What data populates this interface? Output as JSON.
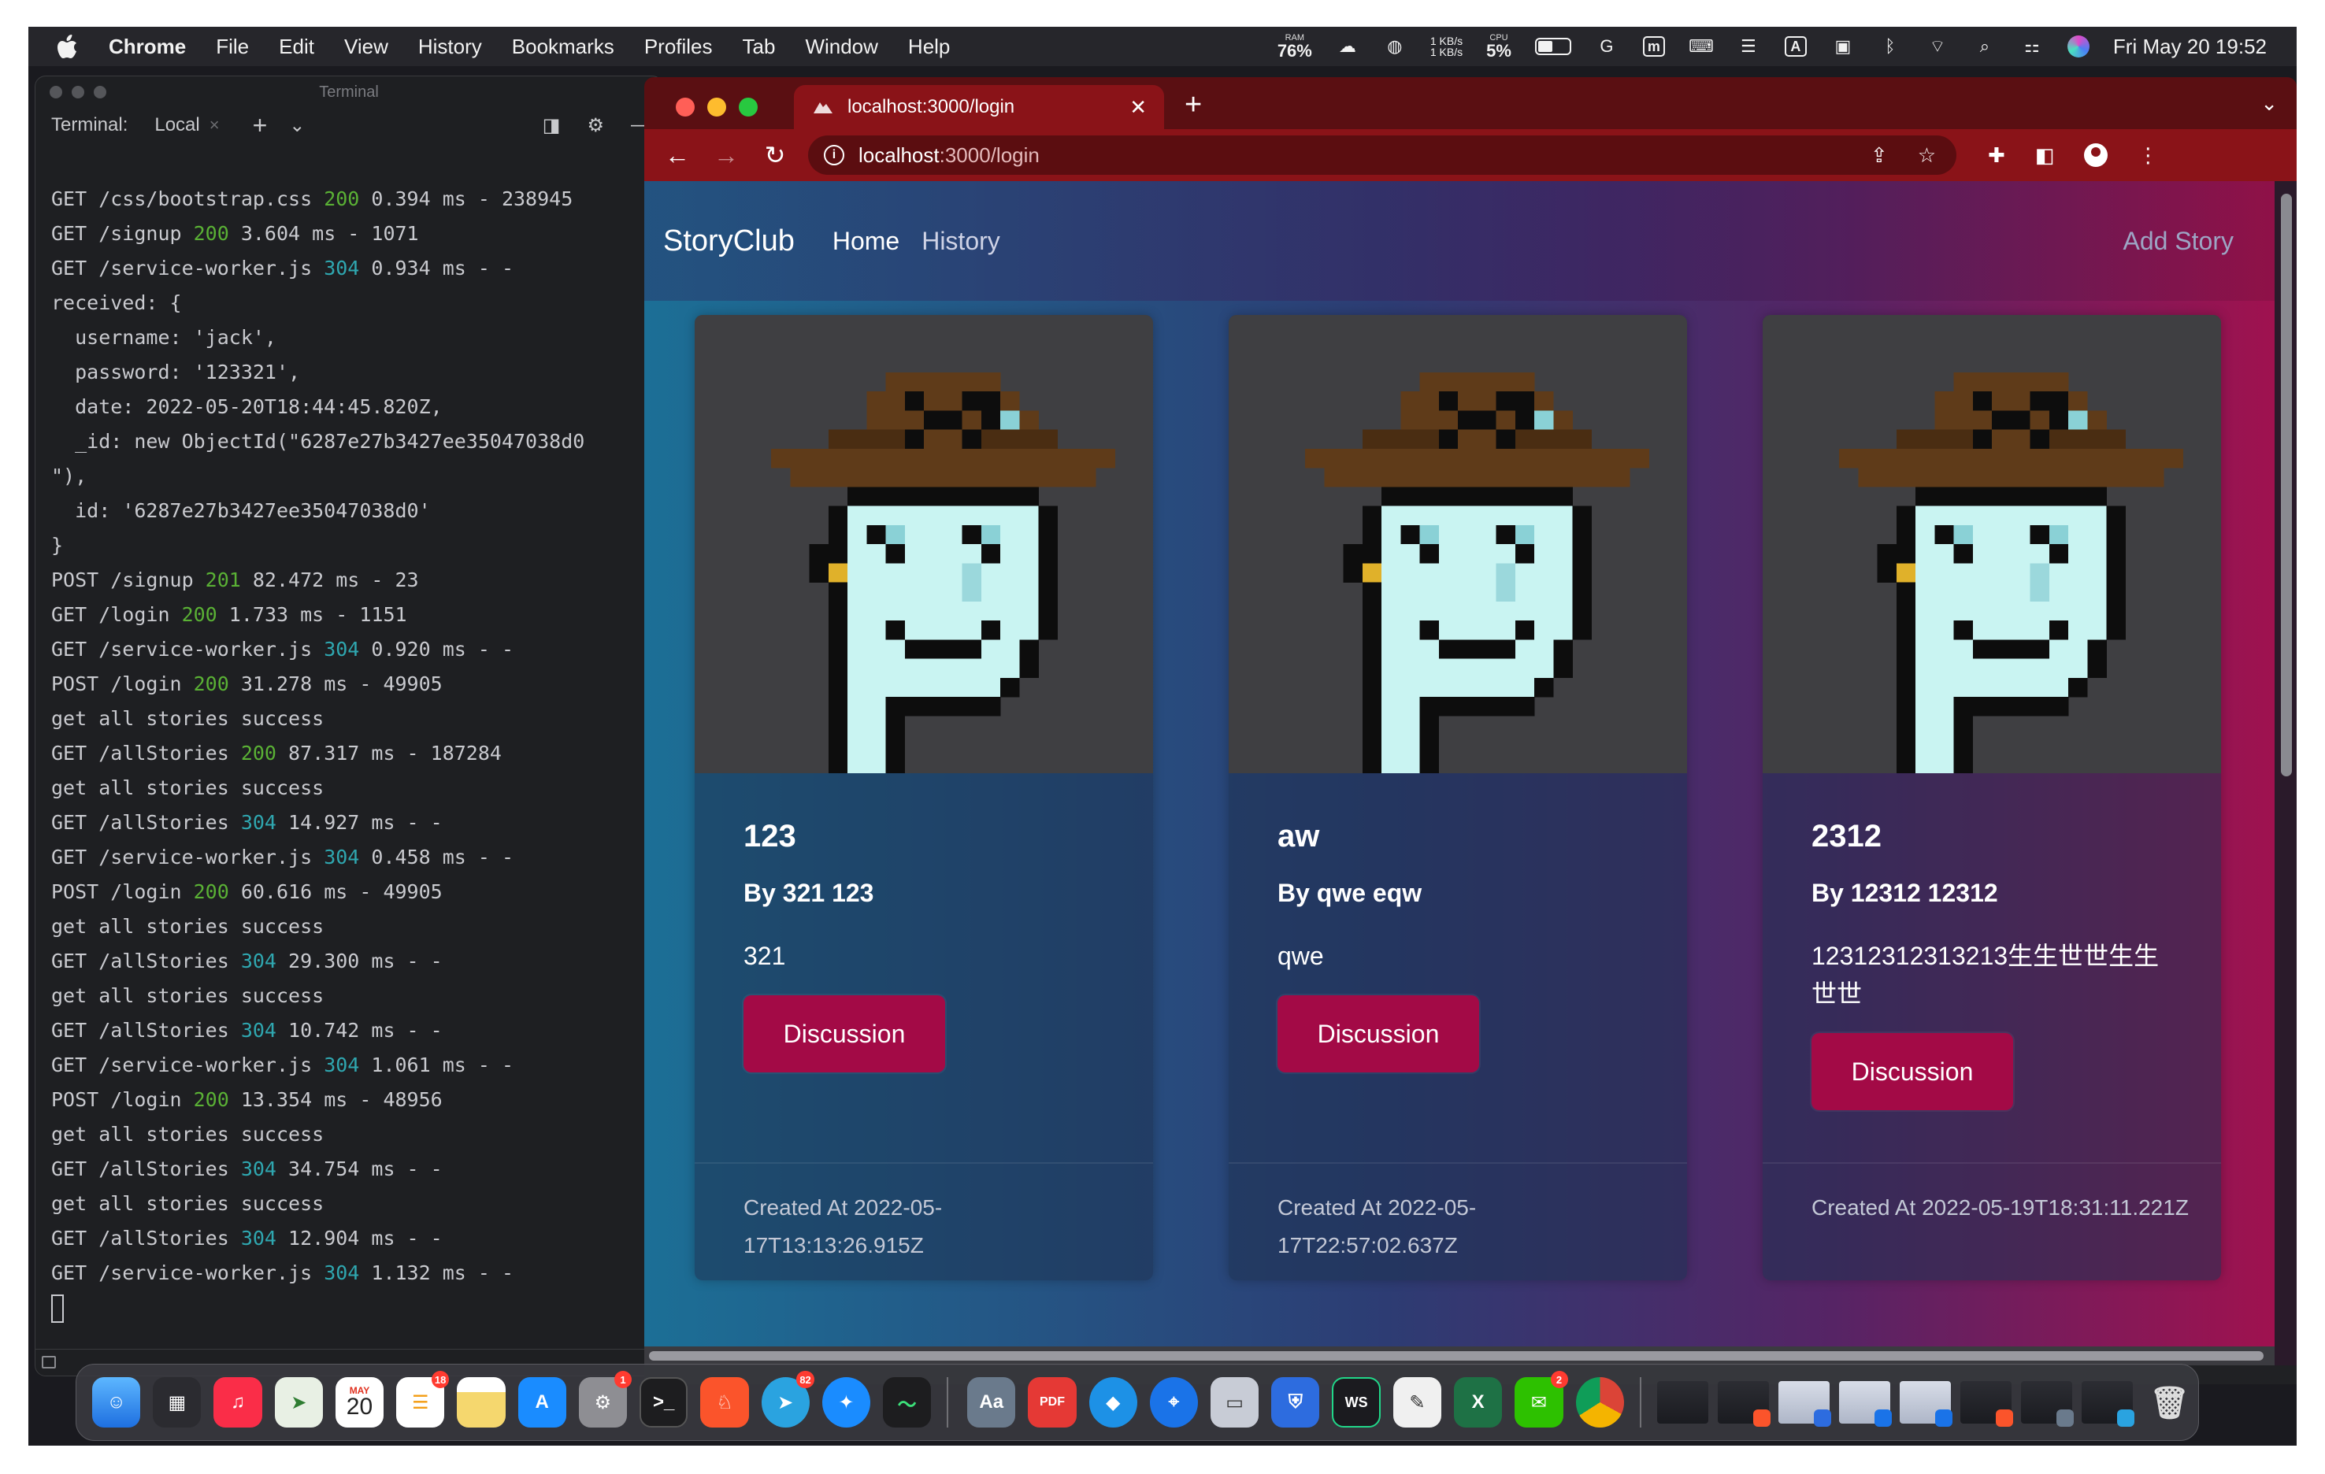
{
  "menubar": {
    "active_app": "Chrome",
    "menus": [
      "File",
      "Edit",
      "View",
      "History",
      "Bookmarks",
      "Profiles",
      "Tab",
      "Window",
      "Help"
    ],
    "ram_label": "RAM",
    "ram_value": "76%",
    "network_up": "1 KB/s",
    "network_down": "1 KB/s",
    "cpu_label": "CPU",
    "cpu_value": "5%",
    "clock": "Fri May 20  19:52"
  },
  "terminal": {
    "window_title": "Terminal",
    "tab_label": "Terminal:",
    "tab_name": "Local",
    "lines": [
      [
        {
          "t": "GET /css/bootstrap.css "
        },
        {
          "t": "200",
          "c": "st-200"
        },
        {
          "t": " 0.394 ms - 238945"
        }
      ],
      [
        {
          "t": "GET /signup "
        },
        {
          "t": "200",
          "c": "st-200"
        },
        {
          "t": " 3.604 ms - 1071"
        }
      ],
      [
        {
          "t": "GET /service-worker.js "
        },
        {
          "t": "304",
          "c": "st-304"
        },
        {
          "t": " 0.934 ms - -"
        }
      ],
      [
        {
          "t": "received: {"
        }
      ],
      [
        {
          "t": "  username: 'jack',"
        }
      ],
      [
        {
          "t": "  password: '123321',"
        }
      ],
      [
        {
          "t": "  date: 2022-05-20T18:44:45.820Z,"
        }
      ],
      [
        {
          "t": "  _id: new ObjectId(\"6287e27b3427ee35047038d0"
        }
      ],
      [
        {
          "t": "\"),"
        }
      ],
      [
        {
          "t": "  id: '6287e27b3427ee35047038d0'"
        }
      ],
      [
        {
          "t": "}"
        }
      ],
      [
        {
          "t": "POST /signup "
        },
        {
          "t": "201",
          "c": "st-201"
        },
        {
          "t": " 82.472 ms - 23"
        }
      ],
      [
        {
          "t": "GET /login "
        },
        {
          "t": "200",
          "c": "st-200"
        },
        {
          "t": " 1.733 ms - 1151"
        }
      ],
      [
        {
          "t": "GET /service-worker.js "
        },
        {
          "t": "304",
          "c": "st-304"
        },
        {
          "t": " 0.920 ms - -"
        }
      ],
      [
        {
          "t": "POST /login "
        },
        {
          "t": "200",
          "c": "st-200"
        },
        {
          "t": " 31.278 ms - 49905"
        }
      ],
      [
        {
          "t": "get all stories success"
        }
      ],
      [
        {
          "t": "GET /allStories "
        },
        {
          "t": "200",
          "c": "st-200"
        },
        {
          "t": " 87.317 ms - 187284"
        }
      ],
      [
        {
          "t": "get all stories success"
        }
      ],
      [
        {
          "t": "GET /allStories "
        },
        {
          "t": "304",
          "c": "st-304"
        },
        {
          "t": " 14.927 ms - -"
        }
      ],
      [
        {
          "t": "GET /service-worker.js "
        },
        {
          "t": "304",
          "c": "st-304"
        },
        {
          "t": " 0.458 ms - -"
        }
      ],
      [
        {
          "t": "POST /login "
        },
        {
          "t": "200",
          "c": "st-200"
        },
        {
          "t": " 60.616 ms - 49905"
        }
      ],
      [
        {
          "t": "get all stories success"
        }
      ],
      [
        {
          "t": "GET /allStories "
        },
        {
          "t": "304",
          "c": "st-304"
        },
        {
          "t": " 29.300 ms - -"
        }
      ],
      [
        {
          "t": "get all stories success"
        }
      ],
      [
        {
          "t": "GET /allStories "
        },
        {
          "t": "304",
          "c": "st-304"
        },
        {
          "t": " 10.742 ms - -"
        }
      ],
      [
        {
          "t": "GET /service-worker.js "
        },
        {
          "t": "304",
          "c": "st-304"
        },
        {
          "t": " 1.061 ms - -"
        }
      ],
      [
        {
          "t": "POST /login "
        },
        {
          "t": "200",
          "c": "st-200"
        },
        {
          "t": " 13.354 ms - 48956"
        }
      ],
      [
        {
          "t": "get all stories success"
        }
      ],
      [
        {
          "t": "GET /allStories "
        },
        {
          "t": "304",
          "c": "st-304"
        },
        {
          "t": " 34.754 ms - -"
        }
      ],
      [
        {
          "t": "get all stories success"
        }
      ],
      [
        {
          "t": "GET /allStories "
        },
        {
          "t": "304",
          "c": "st-304"
        },
        {
          "t": " 12.904 ms - -"
        }
      ],
      [
        {
          "t": "GET /service-worker.js "
        },
        {
          "t": "304",
          "c": "st-304"
        },
        {
          "t": " 1.132 ms - -"
        }
      ]
    ]
  },
  "browser": {
    "tab_title": "localhost:3000/login",
    "url_host": "localhost",
    "url_path": ":3000/login"
  },
  "app": {
    "brand": "StoryClub",
    "nav": [
      "Home",
      "History"
    ],
    "add_story": "Add Story",
    "button_label": "Discussion",
    "stories": [
      {
        "title": "123",
        "author": "By 321 123",
        "description": "321",
        "created": "Created At 2022-05-17T13:13:26.915Z"
      },
      {
        "title": "aw",
        "author": "By qwe eqw",
        "description": "qwe",
        "created": "Created At 2022-05-17T22:57:02.637Z"
      },
      {
        "title": "2312",
        "author": "By 12312 12312",
        "description": "12312312313213生生世世生生世世",
        "created": "Created At 2022-05-19T18:31:11.221Z"
      }
    ]
  },
  "dock": {
    "calendar_month": "MAY",
    "calendar_day": "20",
    "badges": {
      "reminders": "18",
      "settings": "1",
      "telegram": "82",
      "wechat": "2"
    }
  },
  "colors": {
    "chrome_frame": "#8a1318",
    "accent_button": "#a30a46",
    "status_200": "#5ab135",
    "status_304": "#2fa7b0"
  }
}
